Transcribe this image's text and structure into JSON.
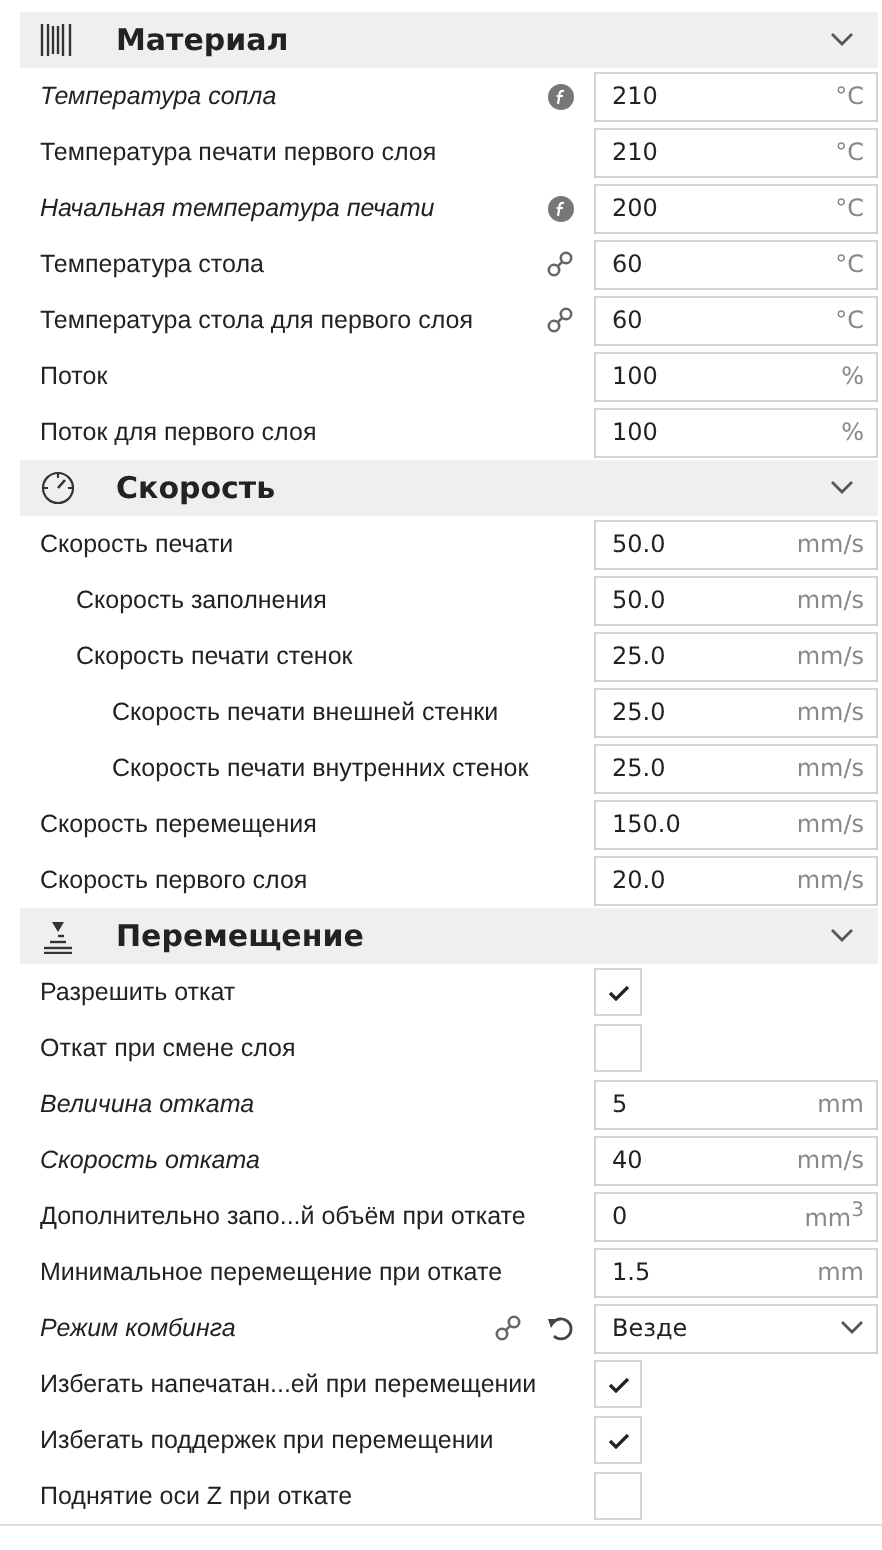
{
  "sections": [
    {
      "kind": "material",
      "title": "Материал",
      "settings": [
        {
          "kind": "number",
          "label": "Температура сопла",
          "modified": true,
          "has_formula": true,
          "value": "210",
          "unit": "°C"
        },
        {
          "kind": "number",
          "label": "Температура печати первого слоя",
          "modified": false,
          "value": "210",
          "unit": "°C"
        },
        {
          "kind": "number",
          "label": "Начальная температура печати",
          "modified": true,
          "has_formula": true,
          "value": "200",
          "unit": "°C"
        },
        {
          "kind": "number",
          "label": "Температура стола",
          "modified": false,
          "linked": true,
          "value": "60",
          "unit": "°C"
        },
        {
          "kind": "number",
          "label": "Температура стола для первого слоя",
          "modified": false,
          "linked": true,
          "value": "60",
          "unit": "°C"
        },
        {
          "kind": "number",
          "label": "Поток",
          "modified": false,
          "value": "100",
          "unit": "%"
        },
        {
          "kind": "number",
          "label": "Поток для первого слоя",
          "modified": false,
          "value": "100",
          "unit": "%"
        }
      ]
    },
    {
      "kind": "speed",
      "title": "Скорость",
      "settings": [
        {
          "kind": "number",
          "label": "Скорость печати",
          "modified": false,
          "value": "50.0",
          "unit": "mm/s",
          "children": [
            {
              "kind": "number",
              "label": "Скорость заполнения",
              "modified": false,
              "value": "50.0",
              "unit": "mm/s"
            },
            {
              "kind": "number",
              "label": "Скорость печати стенок",
              "modified": false,
              "value": "25.0",
              "unit": "mm/s",
              "children": [
                {
                  "kind": "number",
                  "label": "Скорость печати внешней стенки",
                  "modified": false,
                  "value": "25.0",
                  "unit": "mm/s"
                },
                {
                  "kind": "number",
                  "label": "Скорость печати внутренних стенок",
                  "modified": false,
                  "value": "25.0",
                  "unit": "mm/s"
                }
              ]
            }
          ]
        },
        {
          "kind": "number",
          "label": "Скорость перемещения",
          "modified": false,
          "value": "150.0",
          "unit": "mm/s"
        },
        {
          "kind": "number",
          "label": "Скорость первого слоя",
          "modified": false,
          "value": "20.0",
          "unit": "mm/s"
        }
      ]
    },
    {
      "kind": "travel",
      "title": "Перемещение",
      "settings": [
        {
          "kind": "checkbox",
          "label": "Разрешить откат",
          "modified": false,
          "checked": true
        },
        {
          "kind": "checkbox",
          "label": "Откат при смене слоя",
          "modified": false,
          "checked": false
        },
        {
          "kind": "number",
          "label": "Величина отката",
          "modified": true,
          "value": "5",
          "unit": "mm"
        },
        {
          "kind": "number",
          "label": "Скорость отката",
          "modified": true,
          "value": "40",
          "unit": "mm/s"
        },
        {
          "kind": "number",
          "label": "Дополнительно запо...й объём при откате",
          "modified": false,
          "value": "0",
          "unit": "mm$^{3}$"
        },
        {
          "kind": "number",
          "label": "Минимальное перемещение при откате",
          "modified": false,
          "value": "1.5",
          "unit": "mm"
        },
        {
          "kind": "dropdown",
          "label": "Режим комбинга",
          "modified": true,
          "linked": true,
          "resettable": true,
          "value": "Везде"
        },
        {
          "kind": "checkbox",
          "label": "Избегать напечатан...ей при перемещении",
          "modified": false,
          "checked": true
        },
        {
          "kind": "checkbox",
          "label": "Избегать поддержек при перемещении",
          "modified": false,
          "checked": true
        },
        {
          "kind": "checkbox",
          "label": "Поднятие оси Z при откате",
          "modified": false,
          "checked": false
        }
      ]
    }
  ]
}
